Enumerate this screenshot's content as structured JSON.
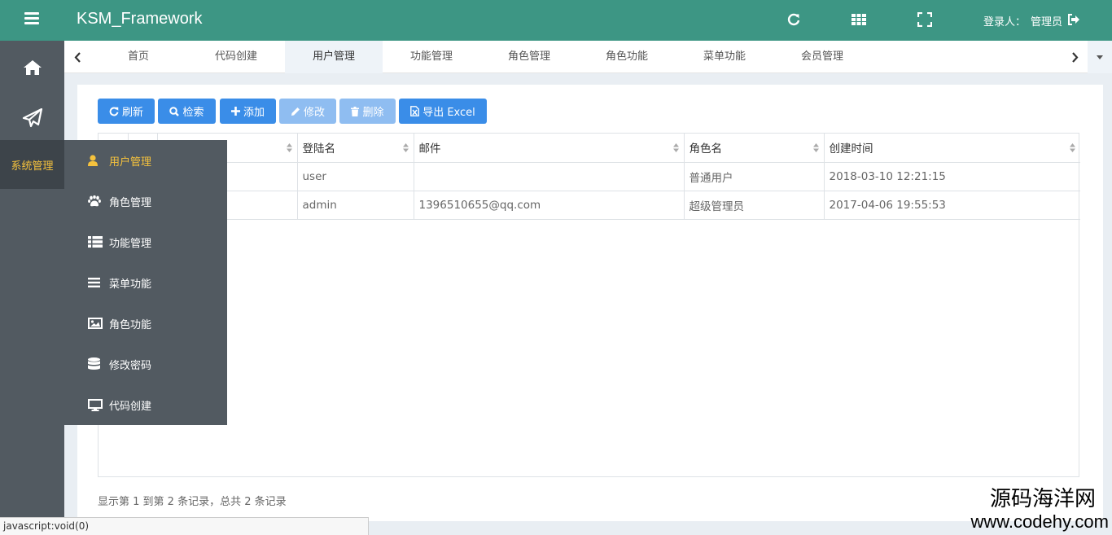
{
  "header": {
    "brand": "KSM_Framework",
    "login_label": "登录人：",
    "login_user": "管理员"
  },
  "sidebar": {
    "section_label": "系统管理"
  },
  "flyout": {
    "items": [
      {
        "label": "用户管理",
        "icon": "user-icon",
        "active": true
      },
      {
        "label": "角色管理",
        "icon": "paw-icon"
      },
      {
        "label": "功能管理",
        "icon": "list-icon"
      },
      {
        "label": "菜单功能",
        "icon": "bars-icon"
      },
      {
        "label": "角色功能",
        "icon": "image-icon"
      },
      {
        "label": "修改密码",
        "icon": "database-icon"
      },
      {
        "label": "代码创建",
        "icon": "desktop-icon"
      }
    ]
  },
  "tabs": {
    "items": [
      "首页",
      "代码创建",
      "用户管理",
      "功能管理",
      "角色管理",
      "角色功能",
      "菜单功能",
      "会员管理"
    ],
    "active": "用户管理"
  },
  "toolbar": {
    "refresh": "刷新",
    "search": "检索",
    "add": "添加",
    "edit": "修改",
    "delete": "删除",
    "export": "导出 Excel"
  },
  "table": {
    "headers": [
      "",
      "",
      "",
      "登陆名",
      "邮件",
      "角色名",
      "创建时间"
    ],
    "rows": [
      [
        "",
        "",
        "",
        "user",
        "",
        "普通用户",
        "2018-03-10 12:21:15"
      ],
      [
        "",
        "",
        "",
        "admin",
        "1396510655@qq.com",
        "超级管理员",
        "2017-04-06 19:55:53"
      ]
    ]
  },
  "pagination": {
    "info": "显示第 1 到第 2 条记录，总共 2 条记录"
  },
  "statusbar": {
    "text": "javascript:void(0)"
  },
  "watermark": {
    "line1": "源码海洋网",
    "line2": "www.codehy.com"
  },
  "colors": {
    "header": "#3d9684",
    "sidebar": "#525a61",
    "accent": "#f5c23d",
    "primary_button": "#3a8de8"
  }
}
